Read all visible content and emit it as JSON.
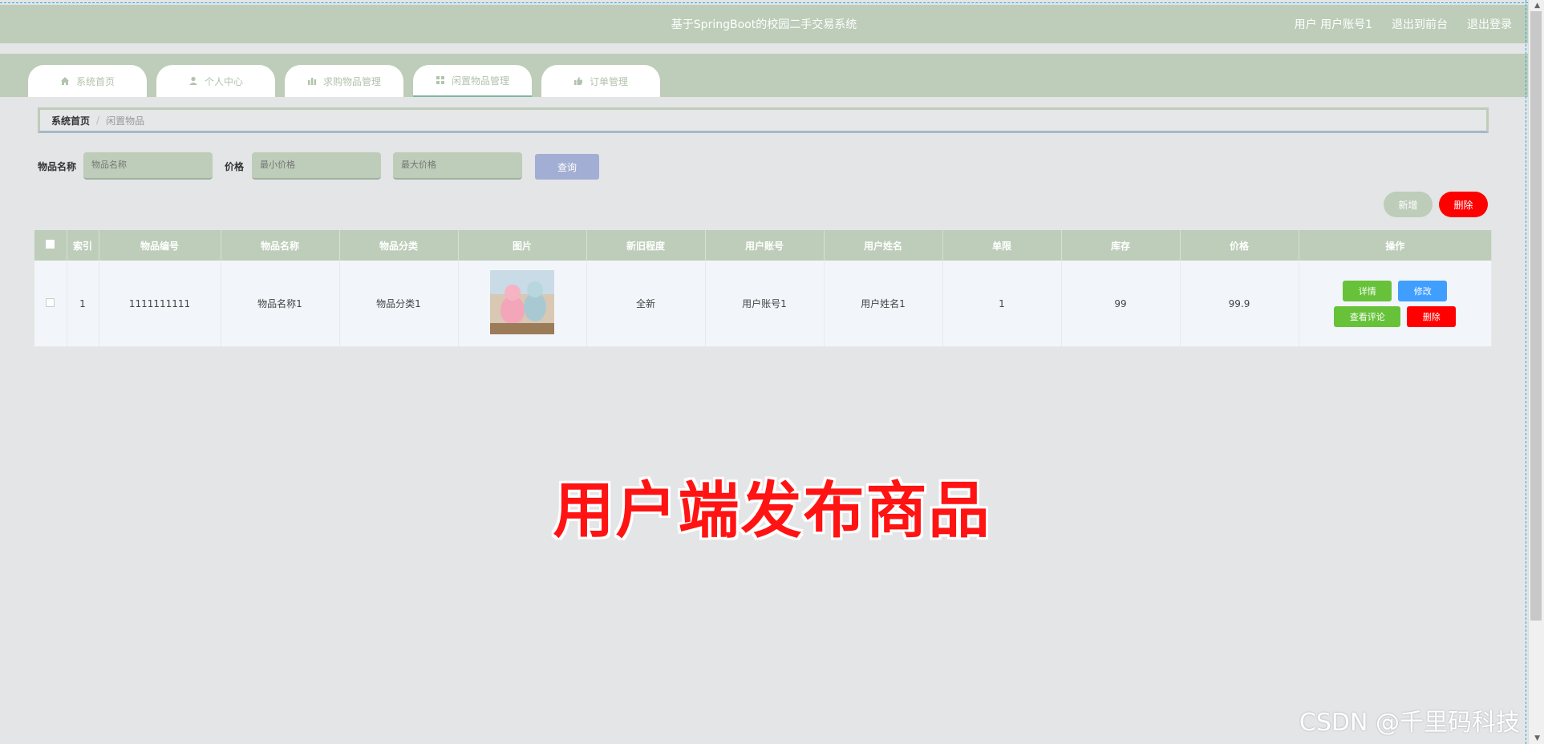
{
  "header": {
    "title": "基于SpringBoot的校园二手交易系统",
    "user_label": "用户 用户账号1",
    "back_front": "退出到前台",
    "logout": "退出登录"
  },
  "tabs": [
    {
      "label": "系统首页",
      "icon": "home-icon"
    },
    {
      "label": "个人中心",
      "icon": "user-icon"
    },
    {
      "label": "求购物品管理",
      "icon": "bar-chart-icon"
    },
    {
      "label": "闲置物品管理",
      "icon": "grid-icon",
      "active": true
    },
    {
      "label": "订单管理",
      "icon": "thumbs-up-icon"
    }
  ],
  "breadcrumb": {
    "home": "系统首页",
    "separator": "/",
    "current": "闲置物品"
  },
  "search": {
    "name_label": "物品名称",
    "name_placeholder": "物品名称",
    "price_label": "价格",
    "price_min_placeholder": "最小价格",
    "price_max_placeholder": "最大价格",
    "query_label": "查询"
  },
  "actions": {
    "add_label": "新增",
    "delete_label": "删除"
  },
  "table": {
    "headers": [
      "索引",
      "物品编号",
      "物品名称",
      "物品分类",
      "图片",
      "新旧程度",
      "用户账号",
      "用户姓名",
      "单限",
      "库存",
      "价格",
      "操作"
    ],
    "rows": [
      {
        "index": "1",
        "code": "1111111111",
        "name": "物品名称1",
        "category": "物品分类1",
        "condition": "全新",
        "account": "用户账号1",
        "username": "用户姓名1",
        "limit": "1",
        "stock": "99",
        "price": "99.9"
      }
    ],
    "row_ops": {
      "detail": "详情",
      "edit": "修改",
      "comments": "查看评论",
      "delete": "删除"
    }
  },
  "overlay_text": "用户端发布商品",
  "watermark": "CSDN @千里码科技",
  "colors": {
    "theme": "#bdcdb9",
    "query_button": "#a3aed4",
    "add_button": "#bdcdb9",
    "delete_button": "#ff0000",
    "detail_button": "#67c23a",
    "edit_button": "#409eff",
    "overlay_text": "#ff1313"
  }
}
